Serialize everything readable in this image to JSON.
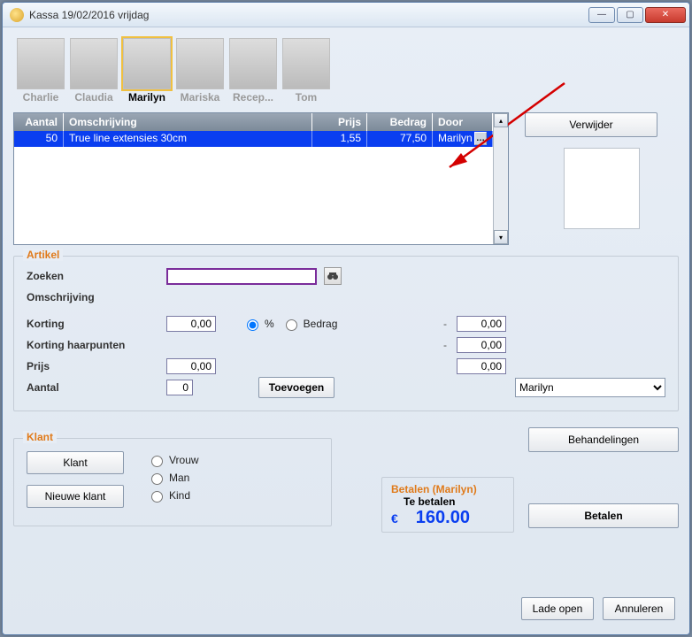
{
  "window": {
    "title": "Kassa 19/02/2016 vrijdag"
  },
  "avatars": [
    {
      "label": "Charlie",
      "selected": false
    },
    {
      "label": "Claudia",
      "selected": false
    },
    {
      "label": "Marilyn",
      "selected": true
    },
    {
      "label": "Mariska",
      "selected": false
    },
    {
      "label": "Recep...",
      "selected": false
    },
    {
      "label": "Tom",
      "selected": false
    }
  ],
  "grid": {
    "headers": {
      "aantal": "Aantal",
      "omschrijving": "Omschrijving",
      "prijs": "Prijs",
      "bedrag": "Bedrag",
      "door": "Door"
    },
    "rows": [
      {
        "aantal": "50",
        "omschrijving": "True line extensies 30cm",
        "prijs": "1,55",
        "bedrag": "77,50",
        "door": "Marilyn"
      }
    ]
  },
  "buttons": {
    "verwijder": "Verwijder",
    "toevoegen": "Toevoegen",
    "klant": "Klant",
    "nieuwe_klant": "Nieuwe klant",
    "behandelingen": "Behandelingen",
    "betalen": "Betalen",
    "lade_open": "Lade open",
    "annuleren": "Annuleren"
  },
  "artikel": {
    "legend": "Artikel",
    "zoeken_label": "Zoeken",
    "omschrijving_label": "Omschrijving",
    "korting_label": "Korting",
    "korting_value": "0,00",
    "korting_pct_label": "%",
    "korting_bedrag_label": "Bedrag",
    "korting_right": "0,00",
    "korting_haarpunten_label": "Korting haarpunten",
    "korting_haarpunten_right": "0,00",
    "prijs_label": "Prijs",
    "prijs_value": "0,00",
    "prijs_right": "0,00",
    "aantal_label": "Aantal",
    "aantal_value": "0",
    "staff_selected": "Marilyn"
  },
  "klant": {
    "legend": "Klant",
    "vrouw": "Vrouw",
    "man": "Man",
    "kind": "Kind"
  },
  "betalen": {
    "legend": "Betalen (Marilyn)",
    "te_betalen_label": "Te betalen",
    "currency": "€",
    "amount": "160.00"
  }
}
